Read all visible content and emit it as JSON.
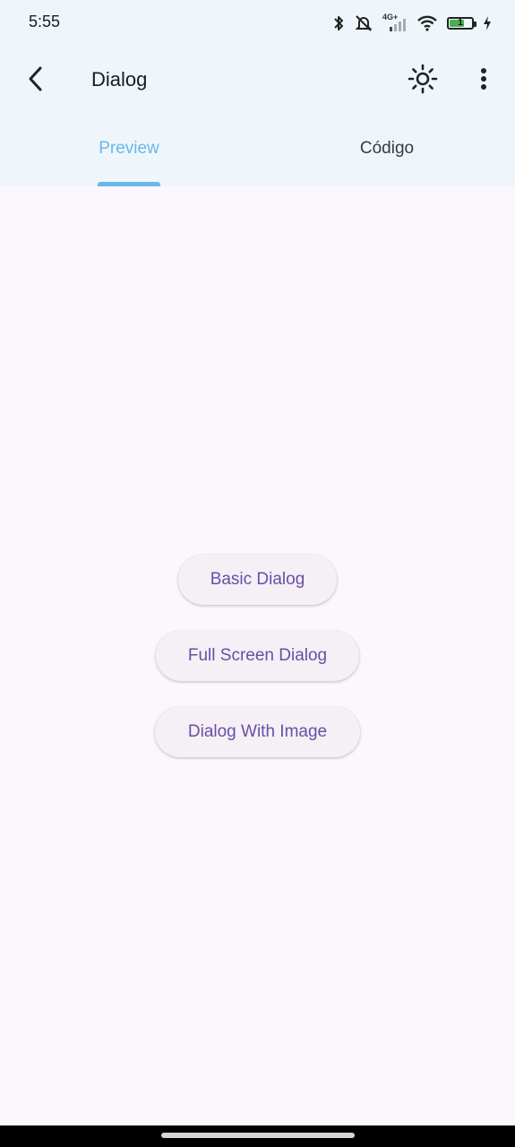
{
  "status_bar": {
    "time": "5:55",
    "network_badge": "4G+",
    "battery_level": "1",
    "icons": [
      "bluetooth-icon",
      "mute-vibrate-icon",
      "signal-icon",
      "wifi-icon",
      "battery-icon",
      "charging-icon"
    ]
  },
  "app_bar": {
    "title": "Dialog",
    "back_icon": "arrow-back-icon",
    "theme_icon": "brightness-icon",
    "more_icon": "more-vert-icon"
  },
  "tabs": [
    {
      "label": "Preview",
      "selected": true
    },
    {
      "label": "Código",
      "selected": false
    }
  ],
  "buttons": {
    "basic": "Basic Dialog",
    "full_screen": "Full Screen Dialog",
    "with_image": "Dialog With Image"
  },
  "colors": {
    "accent": "#6ab8e6",
    "button_text": "#6750a4",
    "surface": "#fcf6fd",
    "app_bar": "#eef6fc"
  }
}
